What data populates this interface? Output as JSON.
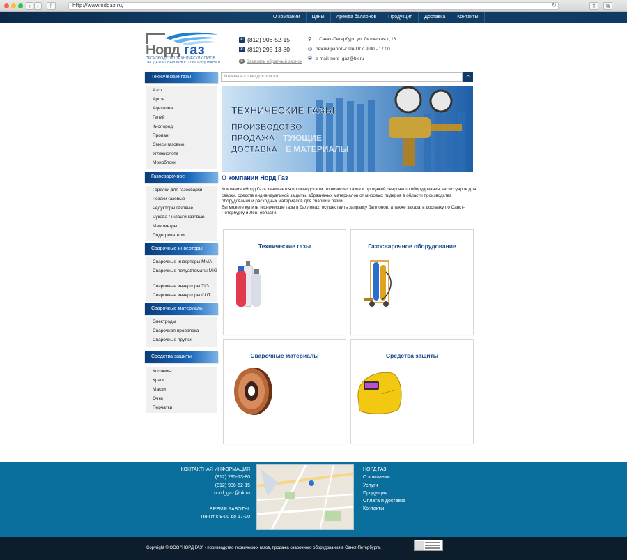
{
  "browser": {
    "url": "http://www.ndgaz.ru/"
  },
  "topnav": [
    "О компании",
    "Цены",
    "Аренда баллонов",
    "Продукция",
    "Доставка",
    "Контакты"
  ],
  "logo": {
    "name": "Норд газ",
    "tagline": "ПРОИЗВОДСТВО ТЕХНИЧЕСКИХ ГАЗОВ ПРОДАЖА СВАРОЧНОГО ОБОРУДОВАНИЯ"
  },
  "header": {
    "phone1": "(812) 906-52-15",
    "phone2": "(812) 295-13-80",
    "callback": "Заказать обратный звонок",
    "address": "г. Санкт-Петербург, ул. Литовская д.16",
    "hours": "режим работы: Пн-Пт с 9.00 - 17.00",
    "email": "e-mail: nord_gaz@bk.ru"
  },
  "search": {
    "placeholder": "Ключевое слово для поиска"
  },
  "banner": {
    "line1": "ТЕХНИЧЕСКИЕ ГАЗЫ",
    "line2": "ПРОИЗВОДСТВО",
    "line3": "ПРОДАЖА",
    "line3b": "ТУЮЩИЕ",
    "line4": "ДОСТАВКА",
    "line4b": "Е МАТЕРИАЛЫ"
  },
  "sidebar": [
    {
      "title": "Технические газы",
      "items": [
        "Азот",
        "Аргон",
        "Ацетилен",
        "Гелий",
        "Кислород",
        "Пропан",
        "Смеси газовые",
        "Углекислота",
        "Моноблоки"
      ]
    },
    {
      "title": "Газосварочное оборудование",
      "items": [
        "Горелки для газосварки",
        "Резаки газовые",
        "Редукторы газовые",
        "Рукава / шланги газовые",
        "Манометры",
        "Подогреватели"
      ]
    },
    {
      "title": "Сварочные инверторы",
      "items": [
        "Сварочные инверторы MMA",
        "Сварочные полуавтоматы MIG",
        "Сварочные инверторы TIG",
        "Сварочные инверторы CUT"
      ]
    },
    {
      "title": "Сварочные материалы",
      "items": [
        "Электроды",
        "Сварочная проволока",
        "Сварочные прутки"
      ]
    },
    {
      "title": "Средства защиты",
      "items": [
        "Костюмы",
        "Краги",
        "Маски",
        "Очки",
        "Перчатки"
      ]
    }
  ],
  "about": {
    "title": "О компании Норд Газ",
    "text1": "Компания «Норд Газ» занимается производством технических газов и продажей сварочного оборудования, аксессуаров для сварки, средств индивидуальной защиты, абразивных материалов от мировых лидеров в области производства оборудования и расходных материалов для сварки и резки.",
    "text2": "Вы можете купить технические газы в баллонах, осуществить заправку баллонов, а также заказать доставку по Санкт-Петербургу и Лен. области."
  },
  "cards": [
    "Технические газы",
    "Газосварочное оборудование",
    "Сварочные материалы",
    "Средства защиты"
  ],
  "footer": {
    "contact_title": "КОНТАКТНАЯ ИНФОРМАЦИЯ",
    "phone1": "(812) 295-13-80",
    "phone2": "(812) 906-52-15",
    "email": "nord_gaz@bk.ru",
    "hours_title": "ВРЕМЯ РАБОТЫ:",
    "hours": "Пн-Пт с 9-00 до 17-00",
    "links": [
      "НОРД ГАЗ",
      "О компании",
      "Услуги",
      "Продукция",
      "Оплата и доставка",
      "Контакты"
    ],
    "copyright": "Copyright © ООО \"НОРД ГАЗ\" - производство технических газов, продажа сварочного оборудования в Санкт-Петербурге."
  }
}
